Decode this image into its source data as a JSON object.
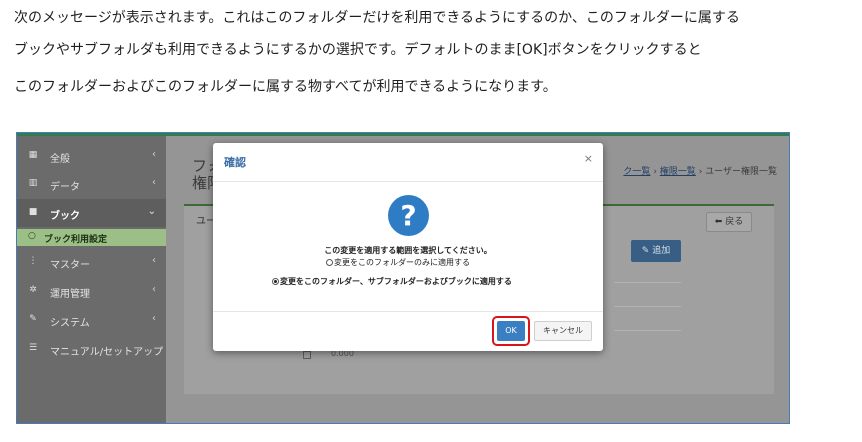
{
  "article": {
    "line1": "次のメッセージが表示されます。これはこのフォルダーだけを利用できるようにするのか、このフォルダーに属する",
    "line2": "ブックやサブフォルダも利用できるようにするかの選択です。デフォルトのまま[OK]ボタンをクリックすると",
    "line3": "このフォルダーおよびこのフォルダーに属する物すべてが利用できるようになります。"
  },
  "sidebar": {
    "items": [
      {
        "label": "全般",
        "icon": "grid-icon",
        "glyph": "▦",
        "chevron": "‹"
      },
      {
        "label": "データ",
        "icon": "chart-icon",
        "glyph": "▥",
        "chevron": "‹"
      },
      {
        "label": "ブック",
        "icon": "book-icon",
        "glyph": "■",
        "chevron": "⌄"
      },
      {
        "label": "マスター",
        "icon": "sitemap-icon",
        "glyph": "⋮",
        "chevron": "‹"
      },
      {
        "label": "運用管理",
        "icon": "gears-icon",
        "glyph": "✲",
        "chevron": "‹"
      },
      {
        "label": "システム",
        "icon": "wrench-icon",
        "glyph": "✎",
        "chevron": "‹"
      },
      {
        "label": "マニュアル/セットアップ",
        "icon": "list-icon",
        "glyph": "☰",
        "chevron": ""
      }
    ],
    "sub_item": {
      "label": "ブック利用設定",
      "icon": "circle-icon",
      "glyph": "○"
    }
  },
  "page": {
    "title_line1": "フォ",
    "title_line2": "権限",
    "breadcrumb_link1": "ク一覧",
    "breadcrumb_link2": "権限一覧",
    "breadcrumb_current": "ユーザー権限一覧",
    "breadcrumb_sep": "›",
    "panel_label": "ユー",
    "back_button": "⬅ 戻る",
    "add_button": "✎ 追加",
    "row_value": "0.000"
  },
  "modal": {
    "title": "確認",
    "close": "×",
    "icon": "question-icon",
    "icon_glyph": "?",
    "prompt": "この変更を適用する範囲を選択してください。",
    "option1": "変更をこのフォルダーのみに適用する",
    "option2": "変更をこのフォルダー、サブフォルダーおよびブックに適用する",
    "selected_option": 2,
    "ok": "OK",
    "cancel": "キャンセル"
  },
  "colors": {
    "accent": "#3a7fc1",
    "highlight": "#d9141b",
    "sidebar_active_sub": "#9bbf86"
  }
}
